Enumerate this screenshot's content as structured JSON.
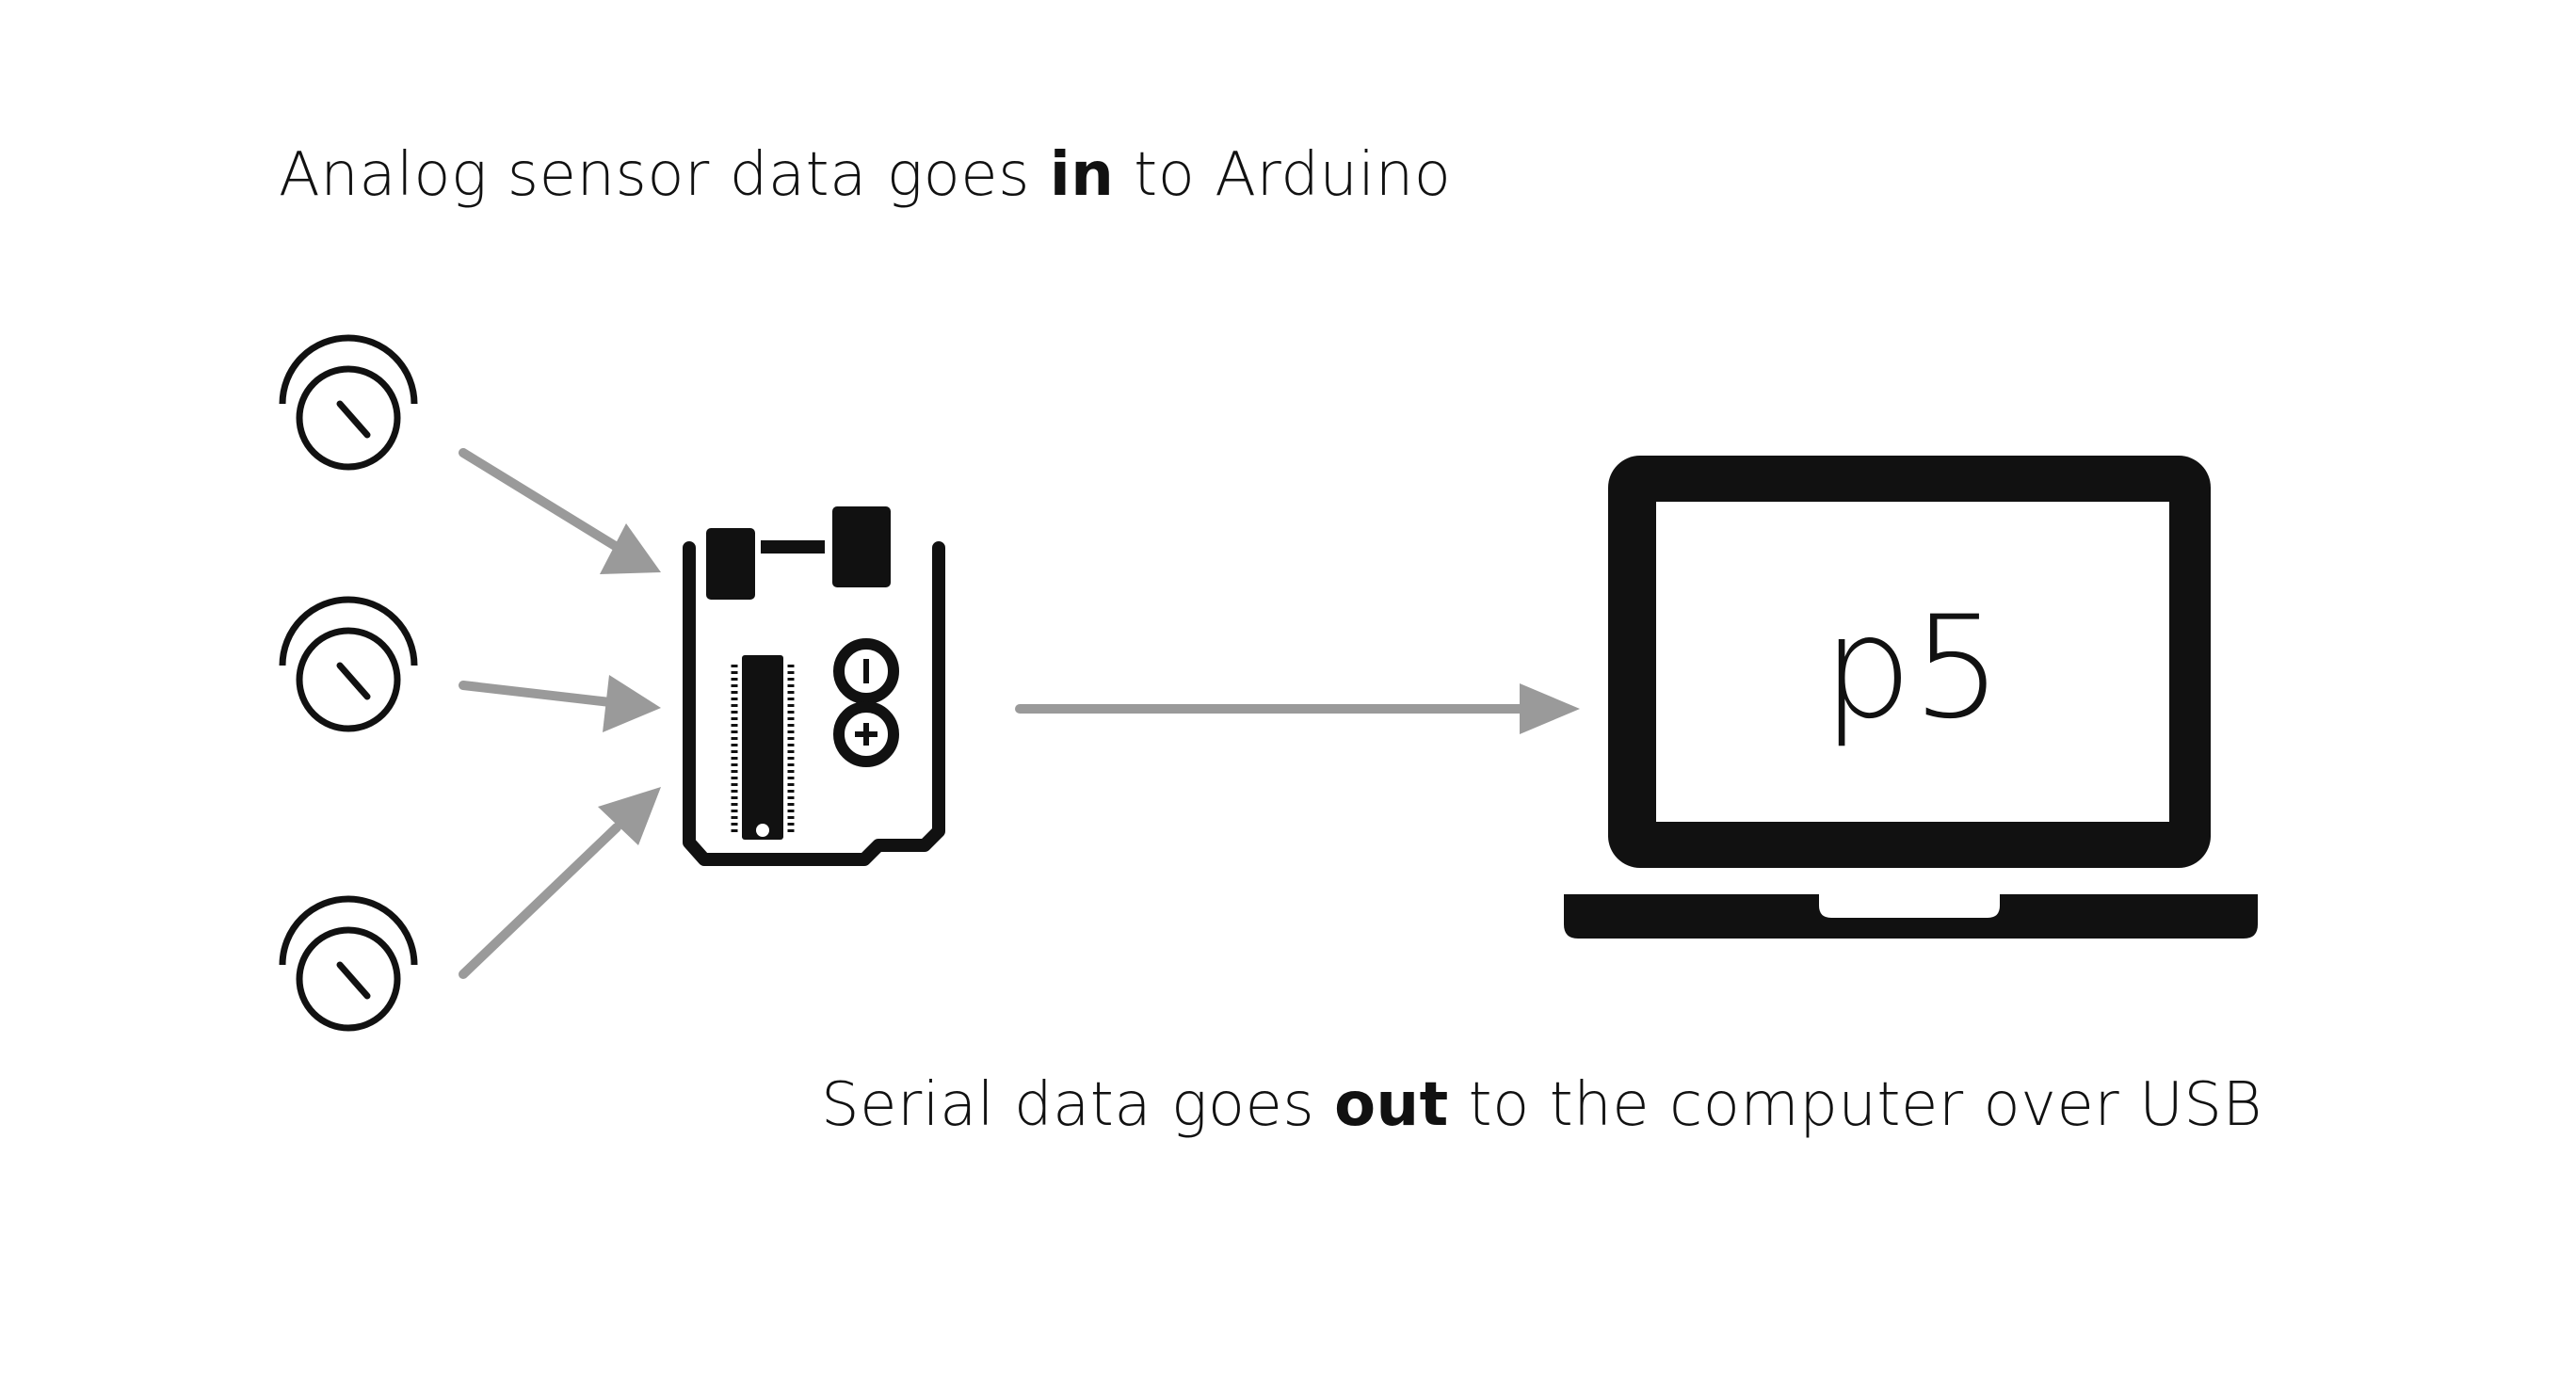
{
  "captions": {
    "top": {
      "before": "Analog sensor data goes ",
      "emphasis": "in",
      "after": " to Arduino"
    },
    "bottom": {
      "before": "Serial data goes ",
      "emphasis": "out",
      "after": " to the computer over USB"
    }
  },
  "laptop": {
    "screen_text": "p5"
  },
  "colors": {
    "ink": "#111111",
    "arrow": "#9a9a9a",
    "background": "#ffffff"
  },
  "icons": [
    "potentiometer-icon",
    "arduino-board-icon",
    "laptop-icon",
    "arrow-icon"
  ]
}
